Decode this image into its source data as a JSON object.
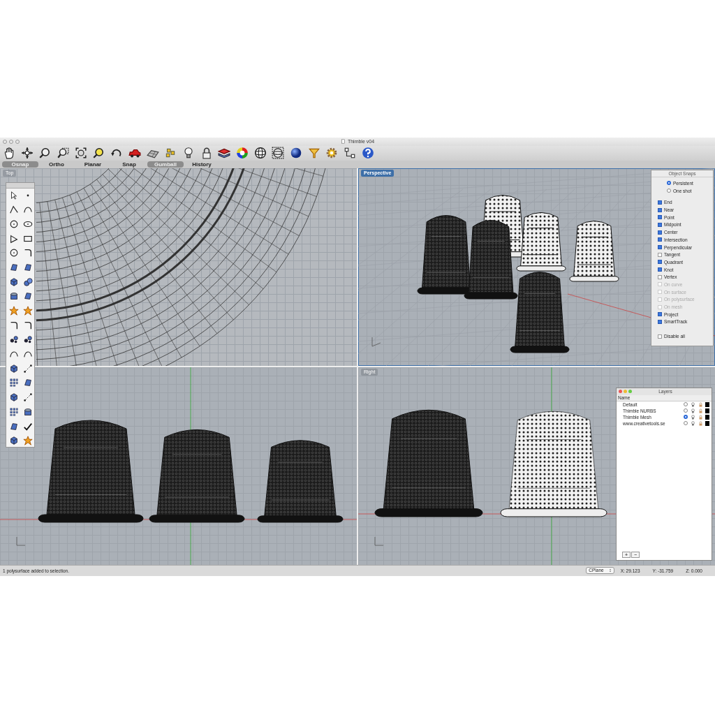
{
  "window": {
    "title": "Thimble v04"
  },
  "toggles": [
    {
      "label": "Osnap",
      "on": true
    },
    {
      "label": "Ortho",
      "on": false
    },
    {
      "label": "Planar",
      "on": false
    },
    {
      "label": "Snap",
      "on": false
    },
    {
      "label": "Gumball",
      "on": true
    },
    {
      "label": "History",
      "on": false
    }
  ],
  "viewports": [
    {
      "kind": "top",
      "title": "Top",
      "selected": false
    },
    {
      "kind": "perspective",
      "title": "Perspective",
      "selected": true
    },
    {
      "kind": "front",
      "selected": false
    },
    {
      "kind": "right",
      "title": "Right",
      "selected": false
    }
  ],
  "object_snaps": {
    "title": "Object Snaps",
    "modes": [
      {
        "label": "Persistent",
        "selected": true
      },
      {
        "label": "One shot",
        "selected": false
      }
    ],
    "snaps": [
      {
        "label": "End",
        "checked": true,
        "disabled": false
      },
      {
        "label": "Near",
        "checked": true,
        "disabled": false
      },
      {
        "label": "Point",
        "checked": true,
        "disabled": false
      },
      {
        "label": "Midpoint",
        "checked": true,
        "disabled": false
      },
      {
        "label": "Center",
        "checked": true,
        "disabled": false
      },
      {
        "label": "Intersection",
        "checked": true,
        "disabled": false
      },
      {
        "label": "Perpendicular",
        "checked": true,
        "disabled": false
      },
      {
        "label": "Tangent",
        "checked": false,
        "disabled": false
      },
      {
        "label": "Quadrant",
        "checked": true,
        "disabled": false
      },
      {
        "label": "Knot",
        "checked": true,
        "disabled": false
      },
      {
        "label": "Vertex",
        "checked": false,
        "disabled": false
      },
      {
        "label": "On curve",
        "checked": false,
        "disabled": true
      },
      {
        "label": "On surface",
        "checked": false,
        "disabled": true
      },
      {
        "label": "On polysurface",
        "checked": false,
        "disabled": true
      },
      {
        "label": "On mesh",
        "checked": false,
        "disabled": true
      },
      {
        "label": "Project",
        "checked": true,
        "disabled": false
      },
      {
        "label": "SmartTrack",
        "checked": true,
        "disabled": false
      }
    ],
    "disable_all": {
      "label": "Disable all",
      "checked": false
    }
  },
  "layers": {
    "title": "Layers",
    "column": "Name",
    "rows": [
      {
        "name": "Default",
        "selected": false
      },
      {
        "name": "Thimble NURBS",
        "selected": false
      },
      {
        "name": "Thimble Mesh",
        "selected": true
      },
      {
        "name": "www.creativetools.se",
        "selected": false
      }
    ],
    "buttons": [
      "+",
      "−"
    ]
  },
  "status_bar": {
    "message": "1 polysurface added to selection.",
    "cplane": "CPlane",
    "x": "X: 29.123",
    "y": "Y: -31.759",
    "z": "Z: 0.000"
  }
}
